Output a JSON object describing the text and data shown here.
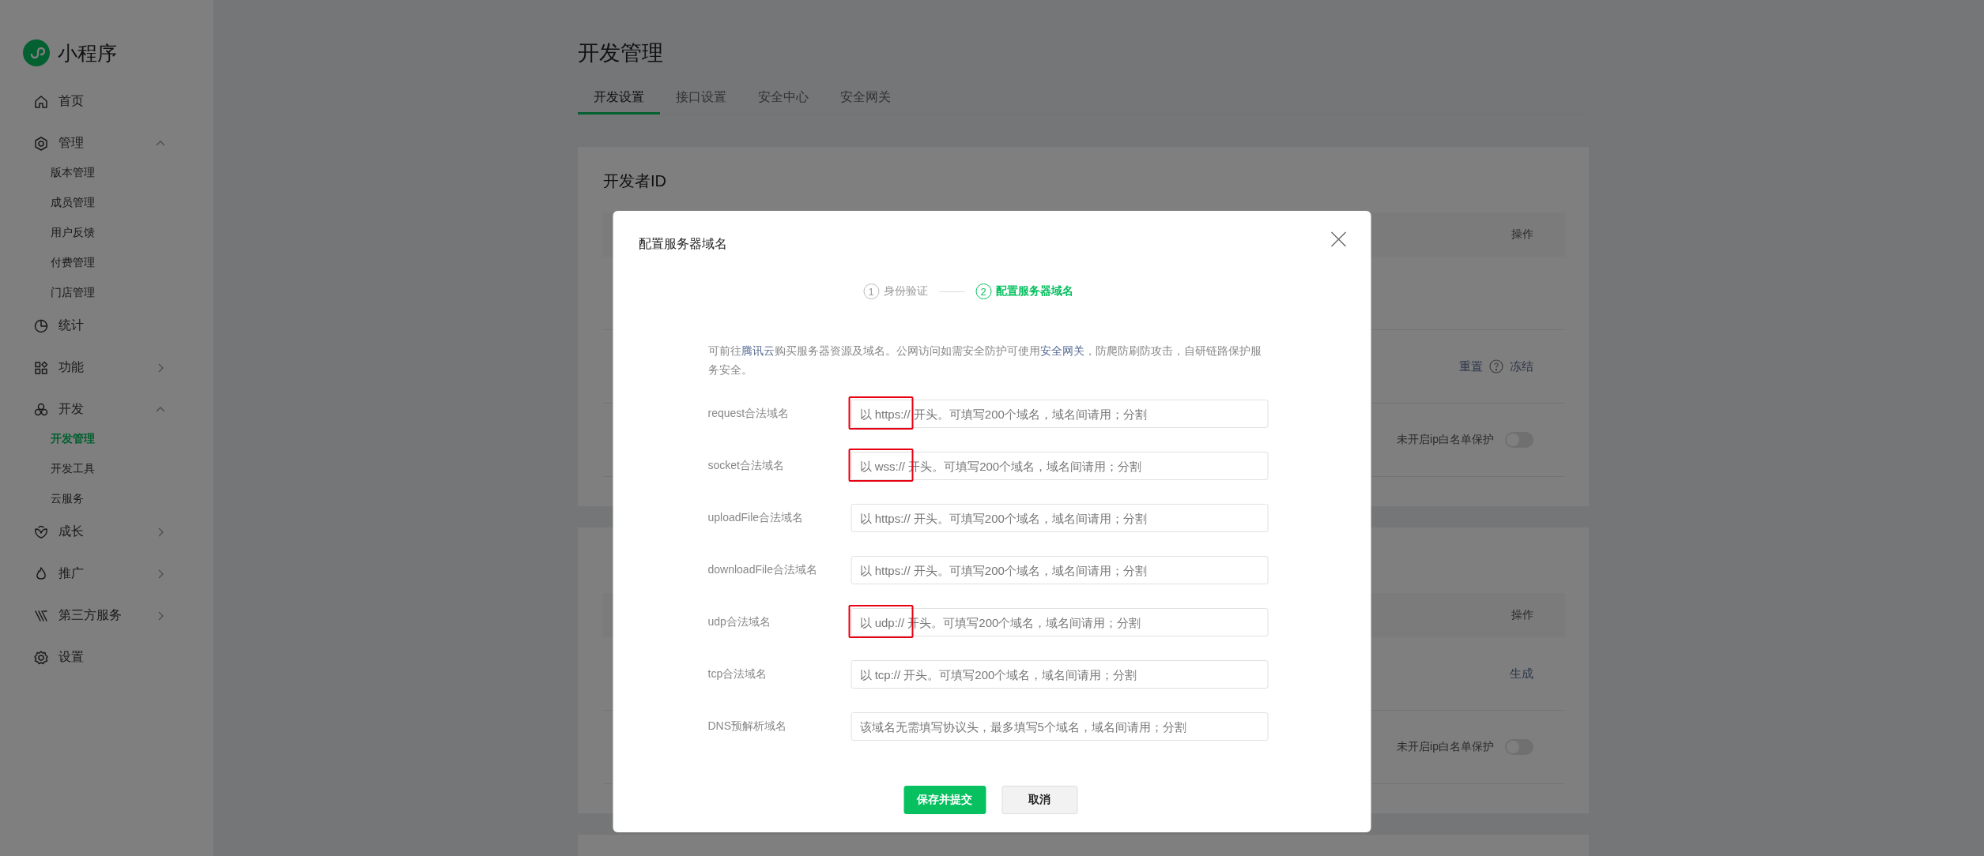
{
  "sidebar": {
    "brand": "小程序",
    "items": [
      {
        "label": "首页",
        "selected": false
      },
      {
        "label": "管理",
        "selected": false,
        "expanded": true,
        "children": [
          {
            "label": "版本管理",
            "selected": false
          },
          {
            "label": "成员管理",
            "selected": false
          },
          {
            "label": "用户反馈",
            "selected": false
          },
          {
            "label": "付费管理",
            "selected": false
          },
          {
            "label": "门店管理",
            "selected": false
          }
        ]
      },
      {
        "label": "统计",
        "selected": false
      },
      {
        "label": "功能",
        "selected": false,
        "expanded": false
      },
      {
        "label": "开发",
        "selected": false,
        "expanded": true,
        "children": [
          {
            "label": "开发管理",
            "selected": true
          },
          {
            "label": "开发工具",
            "selected": false
          },
          {
            "label": "云服务",
            "selected": false
          }
        ]
      },
      {
        "label": "成长",
        "selected": false,
        "expanded": false
      },
      {
        "label": "推广",
        "selected": false,
        "expanded": false
      },
      {
        "label": "第三方服务",
        "selected": false,
        "expanded": false
      },
      {
        "label": "设置",
        "selected": false
      }
    ]
  },
  "page": {
    "title": "开发管理",
    "tabs": [
      {
        "label": "开发设置",
        "selected": true
      },
      {
        "label": "接口设置",
        "selected": false
      },
      {
        "label": "安全中心",
        "selected": false
      },
      {
        "label": "安全网关",
        "selected": false
      }
    ],
    "cards": [
      {
        "title": "开发者ID",
        "action_header": "操作",
        "rows": [
          {
            "kind": "blank"
          },
          {
            "kind": "actions",
            "items": [
              {
                "kind": "link",
                "text": "重置"
              },
              {
                "kind": "help"
              },
              {
                "kind": "link",
                "text": "冻结"
              }
            ]
          },
          {
            "kind": "toggle",
            "label": "未开启ip白名单保护",
            "on": false
          }
        ]
      },
      {
        "action_header": "操作",
        "rows": [
          {
            "kind": "actions",
            "items": [
              {
                "kind": "link",
                "text": "生成"
              }
            ]
          },
          {
            "kind": "toggle",
            "label": "未开启ip白名单保护",
            "on": false
          }
        ]
      },
      {
        "kind": "empty"
      }
    ]
  },
  "modal": {
    "title": "配置服务器域名",
    "steps": [
      {
        "number": "1",
        "label": "身份验证",
        "selected": false
      },
      {
        "number": "2",
        "label": "配置服务器域名",
        "selected": true
      }
    ],
    "description": [
      {
        "kind": "text",
        "text": "可前往"
      },
      {
        "kind": "link",
        "text": "腾讯云"
      },
      {
        "kind": "text",
        "text": "购买服务器资源及域名。公网访问如需安全防护可使用"
      },
      {
        "kind": "link",
        "text": "安全网关"
      },
      {
        "kind": "text",
        "text": "，防爬防刷防攻击，自研链路保护服务安全。"
      }
    ],
    "fields": [
      {
        "label": "request合法域名",
        "placeholder": "以 https:// 开头。可填写200个域名，域名间请用；分割",
        "highlighted": true
      },
      {
        "label": "socket合法域名",
        "placeholder": "以 wss:// 开头。可填写200个域名，域名间请用；分割",
        "highlighted": true
      },
      {
        "label": "uploadFile合法域名",
        "placeholder": "以 https:// 开头。可填写200个域名，域名间请用；分割",
        "highlighted": false
      },
      {
        "label": "downloadFile合法域名",
        "placeholder": "以 https:// 开头。可填写200个域名，域名间请用；分割",
        "highlighted": false
      },
      {
        "label": "udp合法域名",
        "placeholder": "以 udp:// 开头。可填写200个域名，域名间请用；分割",
        "highlighted": true
      },
      {
        "label": "tcp合法域名",
        "placeholder": "以 tcp:// 开头。可填写200个域名，域名间请用；分割",
        "highlighted": false
      },
      {
        "label": "DNS预解析域名",
        "placeholder": "该域名无需填写协议头，最多填写5个域名，域名间请用；分割",
        "highlighted": false
      }
    ],
    "buttons": [
      {
        "label": "保存并提交",
        "kind": "primary"
      },
      {
        "label": "取消",
        "kind": "secondary"
      }
    ]
  }
}
